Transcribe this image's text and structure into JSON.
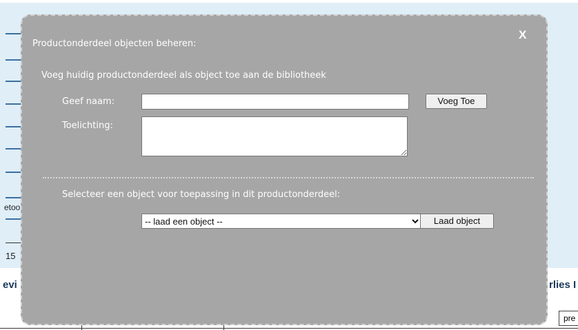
{
  "background": {
    "partial_texts": [
      "etoo",
      "15",
      "evi",
      "rlies I"
    ],
    "button_label": "pre"
  },
  "modal": {
    "title": "Productonderdeel objecten beheren:",
    "close_label": "X",
    "add_section": {
      "heading": "Voeg huidig productonderdeel als object toe aan de bibliotheek",
      "name_label": "Geef naam:",
      "name_value": "",
      "note_label": "Toelichting:",
      "note_value": "",
      "add_button": "Voeg Toe"
    },
    "select_section": {
      "heading": "Selecteer een object voor toepassing in dit productonderdeel:",
      "selected_option": "-- laad een object --",
      "load_button": "Laad object"
    }
  },
  "colors": {
    "modal_bg": "#a6a6a6",
    "page_bg": "#dfeef7",
    "accent_bar": "#3c6fa1"
  }
}
